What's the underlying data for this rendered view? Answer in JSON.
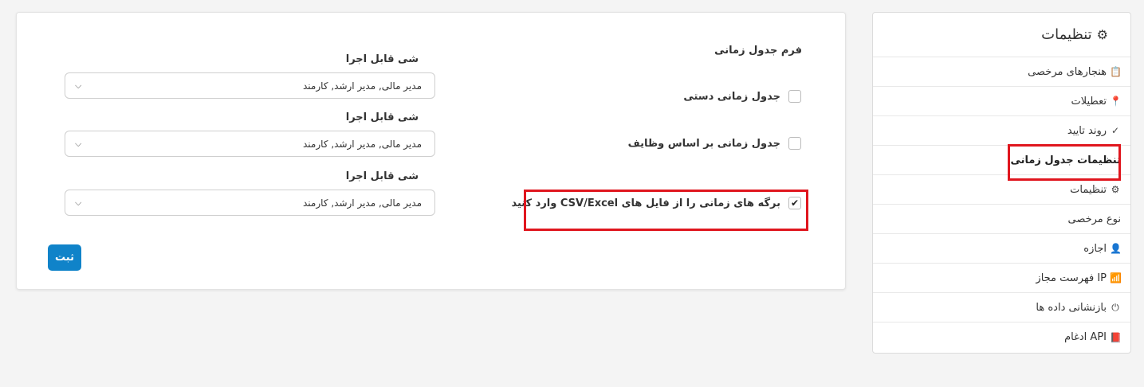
{
  "sidebar": {
    "title": "تنظیمات",
    "items": [
      {
        "label": "هنجارهای مرخصی",
        "icon": "clipboard-icon",
        "glyph": "📋"
      },
      {
        "label": "تعطیلات",
        "icon": "pin-icon",
        "glyph": "📍"
      },
      {
        "label": "روند تایید",
        "icon": "check-icon",
        "glyph": "✓"
      },
      {
        "label": "تنظیمات جدول زمانی",
        "icon": "",
        "glyph": "",
        "active": true
      },
      {
        "label": "تنظیمات",
        "icon": "gear-icon",
        "glyph": "⚙"
      },
      {
        "label": "نوع مرخصی",
        "icon": "",
        "glyph": ""
      },
      {
        "label": "اجازه",
        "icon": "user-icon",
        "glyph": "👤"
      },
      {
        "label": "فهرست مجاز IP",
        "icon": "wifi-icon",
        "glyph": "📶"
      },
      {
        "label": "بازنشانی داده ها",
        "icon": "power-icon",
        "glyph": "⏻"
      },
      {
        "label": "ادغام API",
        "icon": "book-icon",
        "glyph": "📕"
      }
    ]
  },
  "form": {
    "title": "فرم جدول زمانی",
    "options": [
      {
        "label": "جدول زمانی دستی",
        "checked": false,
        "field_label": "شی قابل اجرا",
        "select_value": "مدیر مالی, مدیر ارشد, کارمند"
      },
      {
        "label": "جدول زمانی بر اساس وظایف",
        "checked": false,
        "field_label": "شی قابل اجرا",
        "select_value": "مدیر مالی, مدیر ارشد, کارمند"
      },
      {
        "label": "برگه های زمانی را از فایل های CSV/Excel وارد کنید",
        "checked": true,
        "field_label": "شی قابل اجرا",
        "select_value": "مدیر مالی, مدیر ارشد, کارمند"
      }
    ],
    "submit_label": "ثبت"
  },
  "colors": {
    "accent": "#1083c9",
    "highlight": "#e0161e"
  }
}
